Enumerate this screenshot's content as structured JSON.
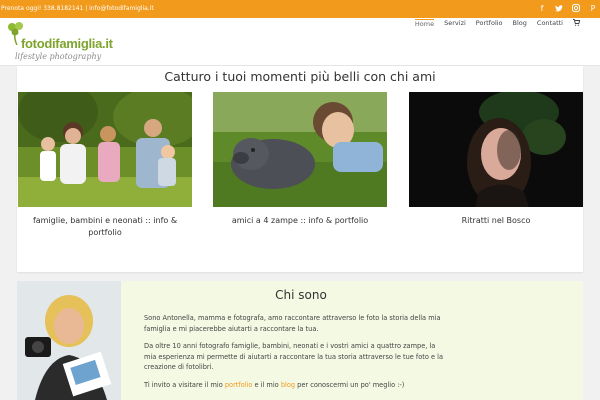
{
  "topbar": {
    "contact": "Prenota oggi! 338.8182141  |  info@fotodifamiglia.it",
    "social": [
      "facebook-icon",
      "twitter-icon",
      "instagram-icon",
      "pinterest-icon"
    ],
    "color": "#f29a1b"
  },
  "logo": {
    "brand": "fotodifamiglia.it",
    "tagline": "lifestyle photography"
  },
  "nav": {
    "items": [
      {
        "label": "Home",
        "active": true
      },
      {
        "label": "Servizi"
      },
      {
        "label": "Portfolio"
      },
      {
        "label": "Blog"
      },
      {
        "label": "Contatti"
      }
    ],
    "cart_icon": "cart-icon"
  },
  "gallery": {
    "title": "Catturo i tuoi momenti più belli con chi ami",
    "cards": [
      {
        "caption": "famiglie, bambini  e neonati :: info & portfolio"
      },
      {
        "caption": "amici a 4 zampe :: info & portfolio"
      },
      {
        "caption": "Ritratti nel Bosco"
      }
    ]
  },
  "about": {
    "title": "Chi sono",
    "p1": "Sono Antonella, mamma e fotografa, amo raccontare attraverso le foto la storia della mia famiglia e mi piacerebbe aiutarti a raccontare la tua.",
    "p2": "Da  oltre 10 anni fotografo famiglie, bambini, neonati e i vostri amici a quattro zampe, la mia esperienza mi permette di aiutarti a raccontare la tua storia attraverso le tue foto e la creazione di fotolibri.",
    "p3_start": "Ti invito a visitare il mio ",
    "p3_link1": "portfolio",
    "p3_mid": " e il mio ",
    "p3_link2": "blog",
    "p3_end": " per conoscermi un po' meglio :-)",
    "bg_color": "#f3f9e3"
  }
}
